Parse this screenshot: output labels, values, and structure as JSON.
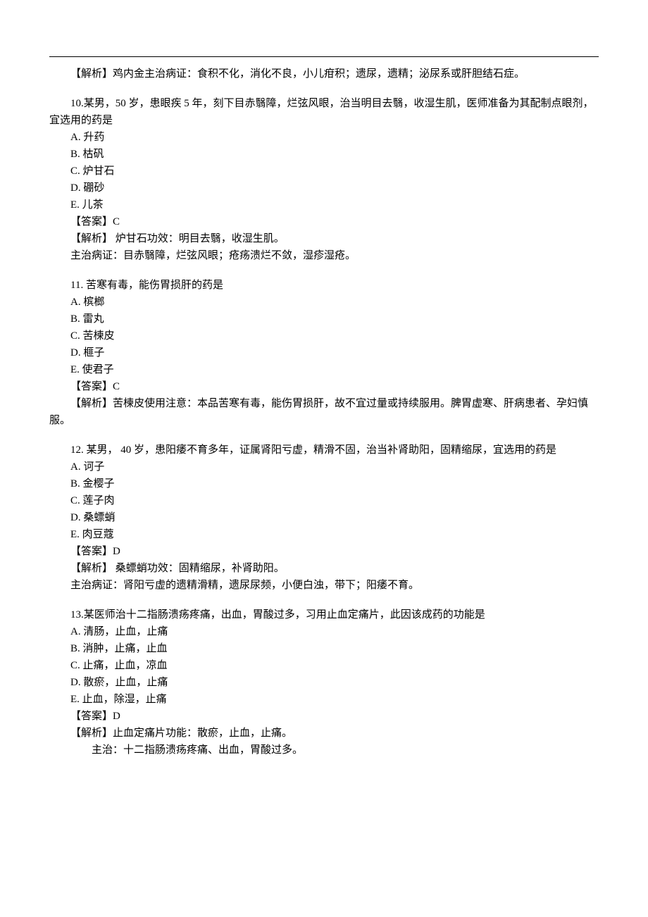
{
  "item9": {
    "analysis": "【解析】鸡内金主治病证：食积不化，消化不良，小儿疳积；遗尿，遗精；泌尿系或肝胆结石症。"
  },
  "item10": {
    "question": "10.某男，50 岁，患眼疾 5 年，刻下目赤翳障，烂弦风眼，治当明目去翳，收湿生肌，医师准备为其配制点眼剂，宜选用的药是",
    "options": {
      "A": "A.  升药",
      "B": "B.  枯矾",
      "C": "C.  炉甘石",
      "D": "D.  硼砂",
      "E": "E.  儿茶"
    },
    "answer": "【答案】C",
    "analysis1": "【解析】  炉甘石功效：明目去翳，收湿生肌。",
    "analysis2": "主治病证：目赤翳障，烂弦风眼；疮疡溃烂不敛，湿疹湿疮。"
  },
  "item11": {
    "question": "11. 苦寒有毒，能伤胃损肝的药是",
    "options": {
      "A": "A.  槟榔",
      "B": "B.  雷丸",
      "C": "C.  苦楝皮",
      "D": "D.  榧子",
      "E": "E.  使君子"
    },
    "answer": "【答案】C",
    "analysis": "【解析】苦楝皮使用注意：本品苦寒有毒，能伤胃损肝，故不宜过量或持续服用。脾胃虚寒、肝病患者、孕妇慎服。"
  },
  "item12": {
    "question": "12. 某男， 40 岁，患阳痿不育多年，证属肾阳亏虚，精滑不固，治当补肾助阳，固精缩尿，宜选用的药是",
    "options": {
      "A": "A.  诃子",
      "B": "B.  金樱子",
      "C": "C.  莲子肉",
      "D": "D.  桑螵蛸",
      "E": "E. 肉豆蔻"
    },
    "answer": "【答案】D",
    "analysis1": "【解析】  桑螵蛸功效：固精缩尿，补肾助阳。",
    "analysis2": "主治病证：肾阳亏虚的遗精滑精，遗尿尿频，小便白浊，带下；阳痿不育。"
  },
  "item13": {
    "question": "13.某医师治十二指肠溃疡疼痛，出血，胃酸过多，习用止血定痛片，此因该成药的功能是",
    "options": {
      "A": "A.  清肠，止血，止痛",
      "B": "B.  消肿，止痛，止血",
      "C": "C.  止痛，止血，凉血",
      "D": "D.  散瘀，止血，止痛",
      "E": "E.  止血，除湿，止痛"
    },
    "answer": "【答案】D",
    "analysis1": "【解析】止血定痛片功能：散瘀，止血，止痛。",
    "analysis2": "主治：十二指肠溃疡疼痛、出血，胃酸过多。"
  }
}
